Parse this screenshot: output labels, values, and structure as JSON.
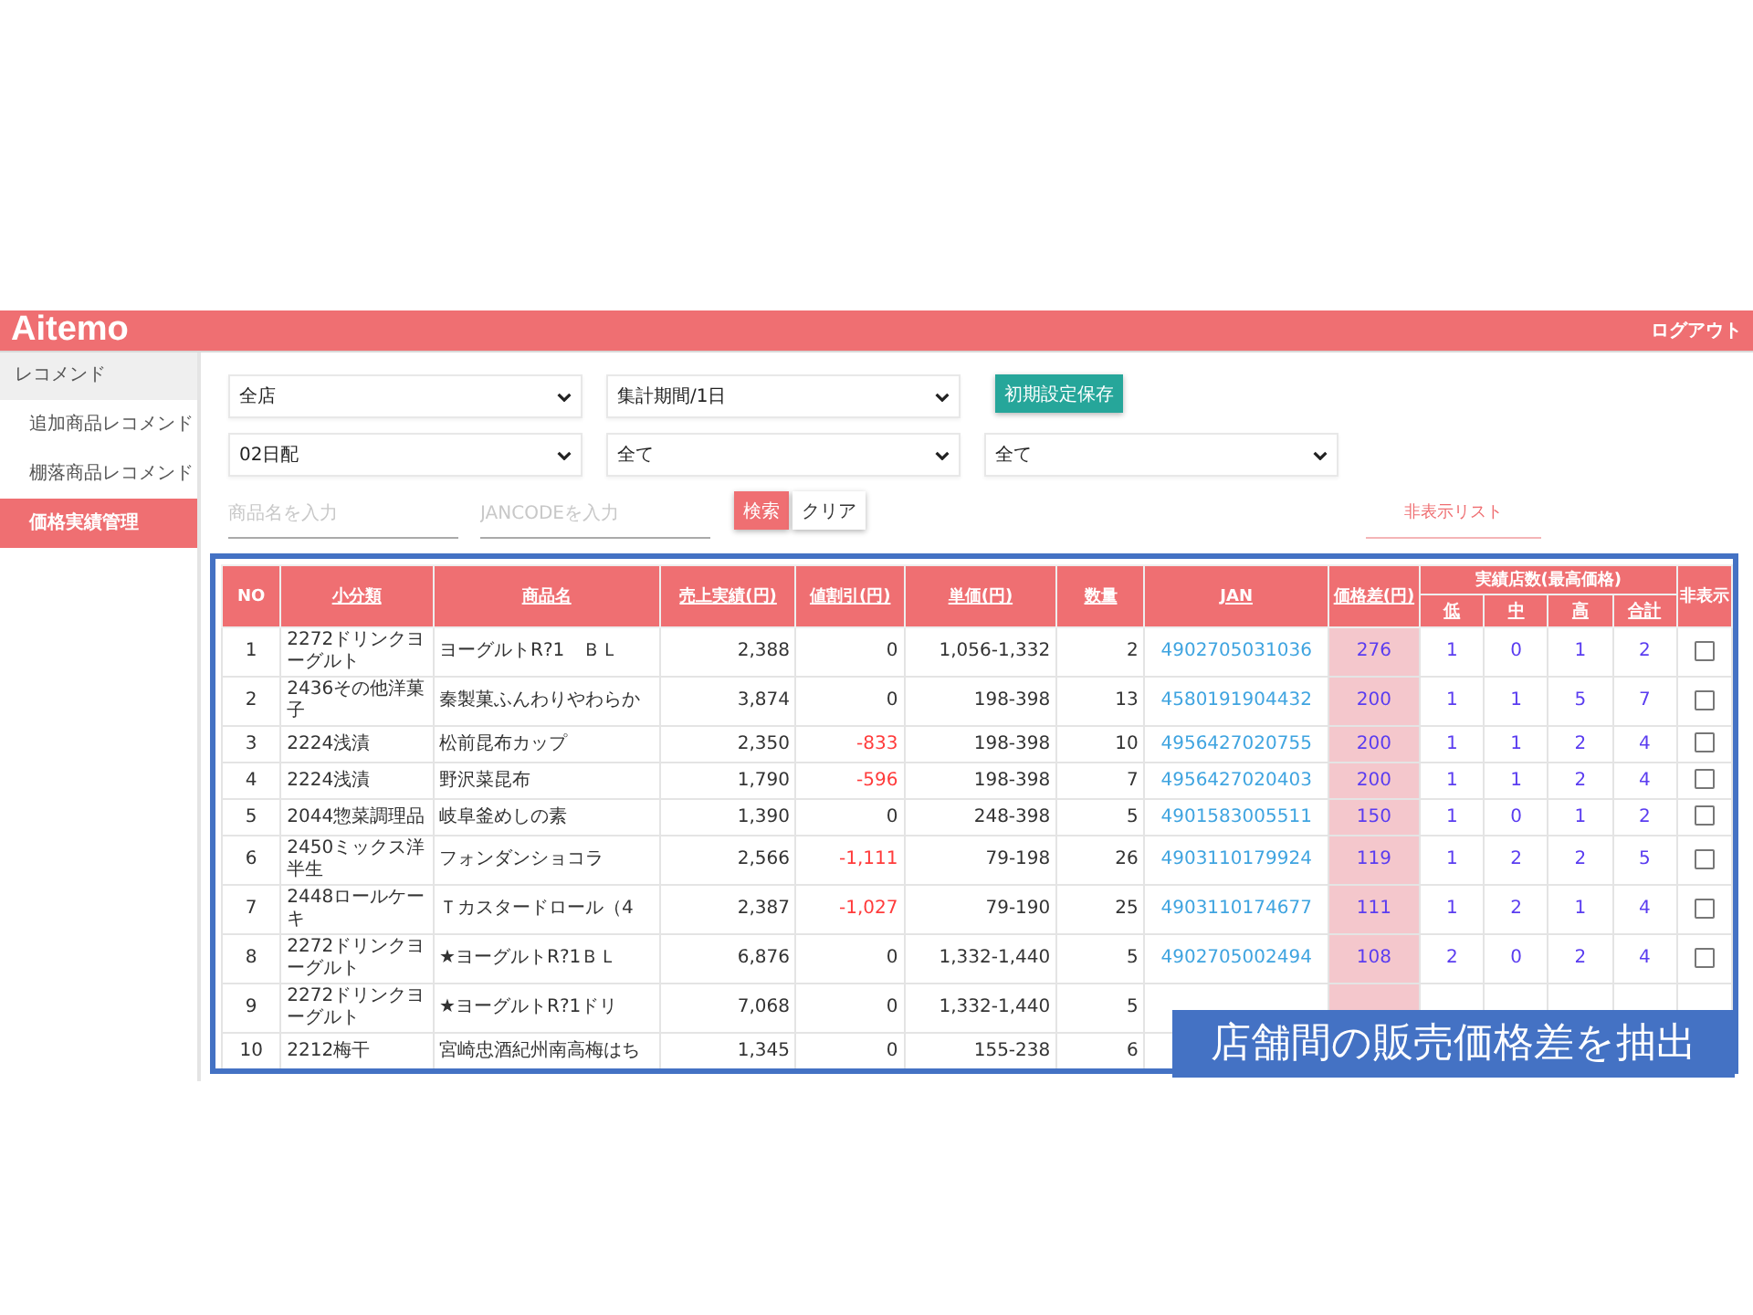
{
  "header": {
    "logo": "Aitemo",
    "logout": "ログアウト"
  },
  "sidebar": {
    "items": [
      {
        "label": "レコメンド",
        "kind": "group",
        "selected": false
      },
      {
        "label": "追加商品レコメンド",
        "kind": "item",
        "selected": false
      },
      {
        "label": "棚落商品レコメンド",
        "kind": "item",
        "selected": false
      },
      {
        "label": "価格実績管理",
        "kind": "item",
        "selected": true
      }
    ]
  },
  "filters": {
    "selects": [
      {
        "value": "全店"
      },
      {
        "value": "集計期間/1日"
      },
      {
        "value": "02日配"
      },
      {
        "value": "全て"
      },
      {
        "value": "全て"
      }
    ],
    "save_button": "初期設定保存",
    "name_input": {
      "placeholder": "商品名を入力"
    },
    "jan_input": {
      "placeholder": "JANCODEを入力"
    },
    "search_button": "検索",
    "clear_button": "クリア",
    "hidden_list_link": "非表示リスト"
  },
  "table": {
    "columns": [
      {
        "label": "NO",
        "sortable": false
      },
      {
        "label": "小分類",
        "sortable": true
      },
      {
        "label": "商品名",
        "sortable": true
      },
      {
        "label": "売上実績(円)",
        "sortable": true
      },
      {
        "label": "値割引(円)",
        "sortable": true
      },
      {
        "label": "単価(円)",
        "sortable": true
      },
      {
        "label": "数量",
        "sortable": true
      },
      {
        "label": "JAN",
        "sortable": true
      },
      {
        "label": "価格差(円)",
        "sortable": true
      },
      {
        "label": "実績店数(最高価格)",
        "sortable": false
      },
      {
        "label": "非表示",
        "sortable": false
      }
    ],
    "store_columns": [
      "低",
      "中",
      "高",
      "合計"
    ],
    "rows": [
      {
        "no": "1",
        "subcategory": "2272ドリンクヨーグルト",
        "product": "ヨーグルトR?1　ＢＬ",
        "sales": "2,388",
        "discount": "0",
        "discount_negative": false,
        "unit_price": "1,056-1,332",
        "quantity": "2",
        "jan": "4902705031036",
        "price_diff": "276",
        "stores": [
          "1",
          "0",
          "1",
          "2"
        ],
        "hidden": false
      },
      {
        "no": "2",
        "subcategory": "2436その他洋菓子",
        "product": "秦製菓ふんわりやわらか",
        "sales": "3,874",
        "discount": "0",
        "discount_negative": false,
        "unit_price": "198-398",
        "quantity": "13",
        "jan": "4580191904432",
        "price_diff": "200",
        "stores": [
          "1",
          "1",
          "5",
          "7"
        ],
        "hidden": false
      },
      {
        "no": "3",
        "subcategory": "2224浅漬",
        "product": "松前昆布カップ",
        "sales": "2,350",
        "discount": "-833",
        "discount_negative": true,
        "unit_price": "198-398",
        "quantity": "10",
        "jan": "4956427020755",
        "price_diff": "200",
        "stores": [
          "1",
          "1",
          "2",
          "4"
        ],
        "hidden": false
      },
      {
        "no": "4",
        "subcategory": "2224浅漬",
        "product": "野沢菜昆布",
        "sales": "1,790",
        "discount": "-596",
        "discount_negative": true,
        "unit_price": "198-398",
        "quantity": "7",
        "jan": "4956427020403",
        "price_diff": "200",
        "stores": [
          "1",
          "1",
          "2",
          "4"
        ],
        "hidden": false
      },
      {
        "no": "5",
        "subcategory": "2044惣菜調理品",
        "product": "岐阜釜めしの素",
        "sales": "1,390",
        "discount": "0",
        "discount_negative": false,
        "unit_price": "248-398",
        "quantity": "5",
        "jan": "4901583005511",
        "price_diff": "150",
        "stores": [
          "1",
          "0",
          "1",
          "2"
        ],
        "hidden": false
      },
      {
        "no": "6",
        "subcategory": "2450ミックス洋半生",
        "product": "フォンダンショコラ",
        "sales": "2,566",
        "discount": "-1,111",
        "discount_negative": true,
        "unit_price": "79-198",
        "quantity": "26",
        "jan": "4903110179924",
        "price_diff": "119",
        "stores": [
          "1",
          "2",
          "2",
          "5"
        ],
        "hidden": false
      },
      {
        "no": "7",
        "subcategory": "2448ロールケーキ",
        "product": "Ｔカスタードロール（4",
        "sales": "2,387",
        "discount": "-1,027",
        "discount_negative": true,
        "unit_price": "79-190",
        "quantity": "25",
        "jan": "4903110174677",
        "price_diff": "111",
        "stores": [
          "1",
          "2",
          "1",
          "4"
        ],
        "hidden": false
      },
      {
        "no": "8",
        "subcategory": "2272ドリンクヨーグルト",
        "product": "★ヨーグルトR?1ＢＬ",
        "sales": "6,876",
        "discount": "0",
        "discount_negative": false,
        "unit_price": "1,332-1,440",
        "quantity": "5",
        "jan": "4902705002494",
        "price_diff": "108",
        "stores": [
          "2",
          "0",
          "2",
          "4"
        ],
        "hidden": false
      },
      {
        "no": "9",
        "subcategory": "2272ドリンクヨーグルト",
        "product": "★ヨーグルトR?1ドリ",
        "sales": "7,068",
        "discount": "0",
        "discount_negative": false,
        "unit_price": "1,332-1,440",
        "quantity": "5"
      },
      {
        "no": "10",
        "subcategory": "2212梅干",
        "product": "宮崎忠酒紀州南高梅はち",
        "sales": "1,345",
        "discount": "0",
        "discount_negative": false,
        "unit_price": "155-238",
        "quantity": "6"
      }
    ]
  },
  "callout": "店舗間の販売価格差を抽出"
}
